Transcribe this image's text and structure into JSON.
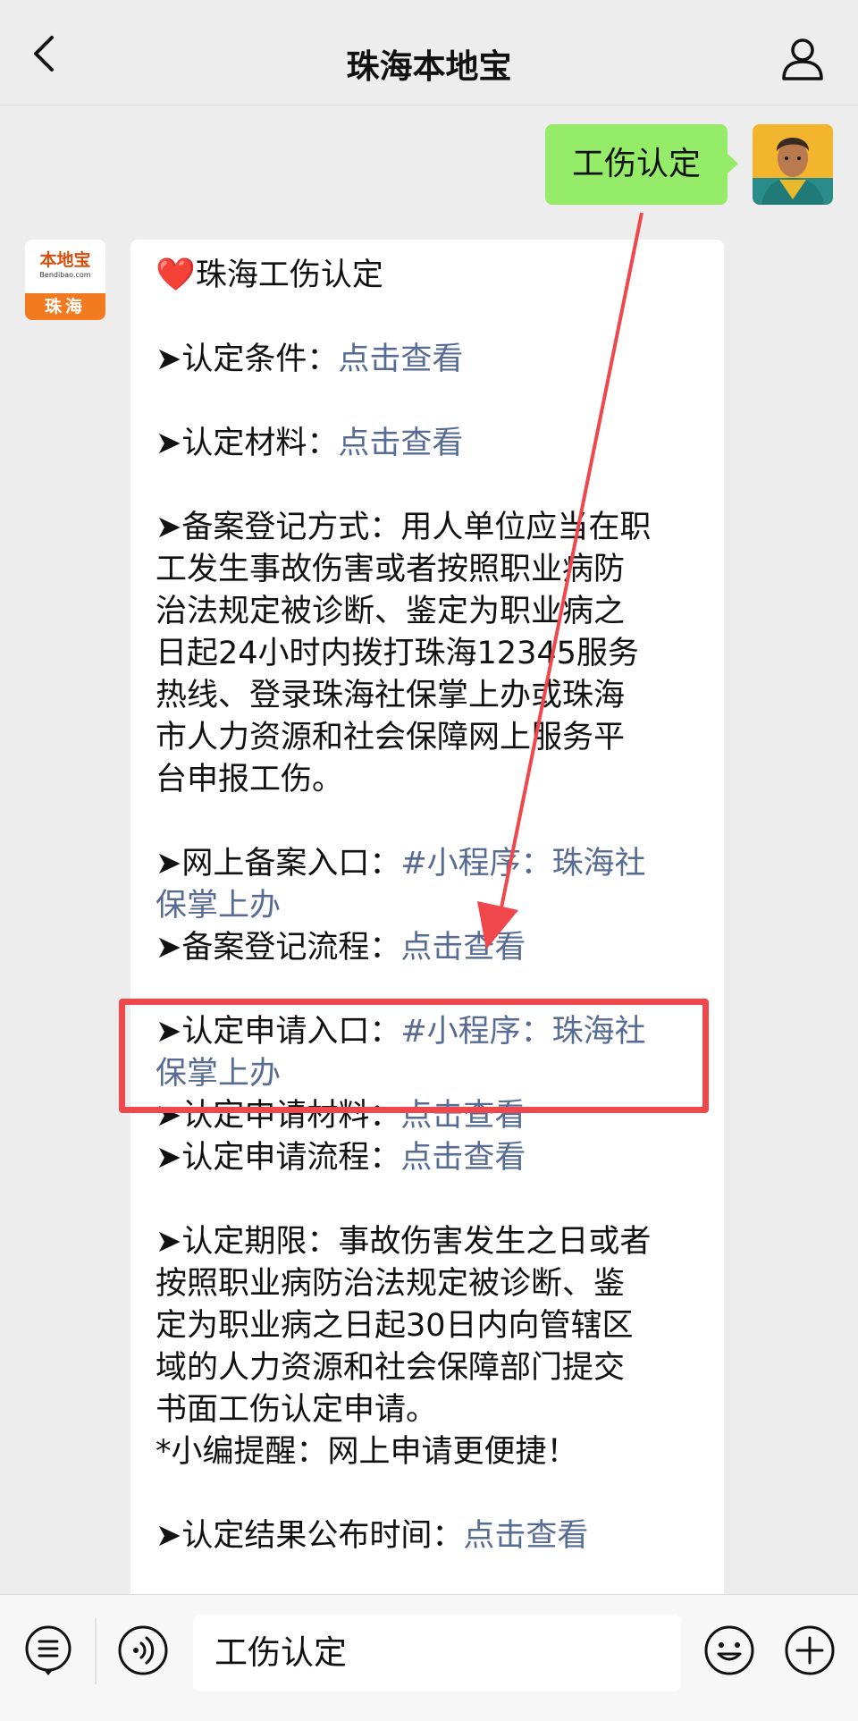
{
  "header": {
    "title": "珠海本地宝"
  },
  "sent": {
    "text": "工伤认定"
  },
  "bot": {
    "avatar_brand": "本地宝",
    "avatar_domain": "Bendibao.com",
    "avatar_city": "珠海"
  },
  "message": {
    "title": "珠海工伤认定",
    "heart": "❤️",
    "conditions_label": "➤认定条件：",
    "conditions_link": "点击查看",
    "materials_label": "➤认定材料：",
    "materials_link": "点击查看",
    "registration_method_lines": [
      "➤备案登记方式：用人单位应当在职",
      "工发生事故伤害或者按照职业病防",
      "治法规定被诊断、鉴定为职业病之",
      "日起24小时内拨打珠海12345服务",
      "热线、登录珠海社保掌上办或珠海",
      "市人力资源和社会保障网上服务平",
      "台申报工伤。"
    ],
    "online_entry_label": "➤网上备案入口：",
    "online_entry_link_1": "#小程序：珠海社",
    "online_entry_link_2": "保掌上办",
    "registration_flow_label": "➤备案登记流程：",
    "registration_flow_link": "点击查看",
    "apply_entry_label": "➤认定申请入口：",
    "apply_entry_link_1": "#小程序：珠海社",
    "apply_entry_link_2": "保掌上办",
    "apply_materials_label": "➤认定申请材料：",
    "apply_materials_link": "点击查看",
    "apply_flow_label": "➤认定申请流程：",
    "apply_flow_link": "点击查看",
    "deadline_lines": [
      "➤认定期限：事故伤害发生之日或者",
      "按照职业病防治法规定被诊断、鉴",
      "定为职业病之日起30日内向管辖区",
      "域的人力资源和社会保障部门提交",
      "书面工伤认定申请。"
    ],
    "reminder": "*小编提醒：网上申请更便捷！",
    "result_label": "➤认定结果公布时间：",
    "result_link": "点击查看"
  },
  "input": {
    "value": "工伤认定"
  },
  "colors": {
    "sent_bubble": "#95ec69",
    "link": "#576b95",
    "highlight": "#f0474d"
  }
}
